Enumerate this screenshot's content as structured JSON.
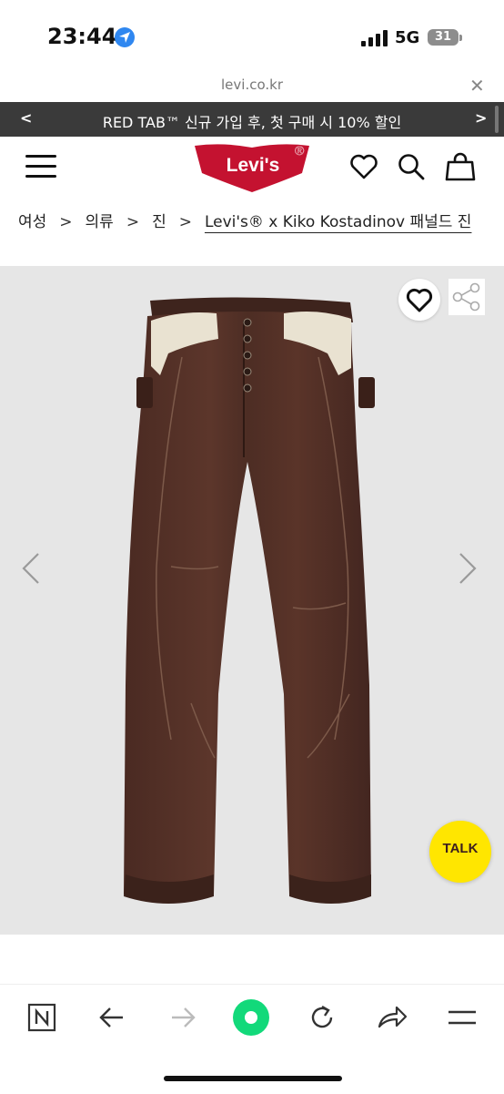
{
  "status_bar": {
    "time": "23:44",
    "network": "5G",
    "battery": "31"
  },
  "browser": {
    "url": "levi.co.kr"
  },
  "promo": {
    "text": "RED TAB™ 신규 가입 후, 첫 구매 시 10% 할인",
    "prev": "<",
    "next": ">"
  },
  "header": {
    "logo_text": "Levi's",
    "logo_mark": "®"
  },
  "breadcrumb": {
    "items": [
      "여성",
      "의류",
      "진"
    ],
    "current": "Levi's® x Kiko Kostadinov 패널드 진",
    "separator": ">"
  },
  "product": {
    "chat_label": "TALK"
  },
  "colors": {
    "promo_bg": "#3a3a3a",
    "logo_red": "#c41230",
    "talk_yellow": "#ffe600",
    "toolbar_green": "#12d97a"
  },
  "icons": [
    "location-icon",
    "signal-icon",
    "battery-icon",
    "close-icon",
    "menu-icon",
    "heart-icon",
    "search-icon",
    "bag-icon",
    "share-icon",
    "chevron-left-icon",
    "chevron-right-icon",
    "naver-icon",
    "back-icon",
    "forward-icon",
    "green-dot-icon",
    "reload-icon",
    "share-arrow-icon",
    "hamburger-icon"
  ]
}
